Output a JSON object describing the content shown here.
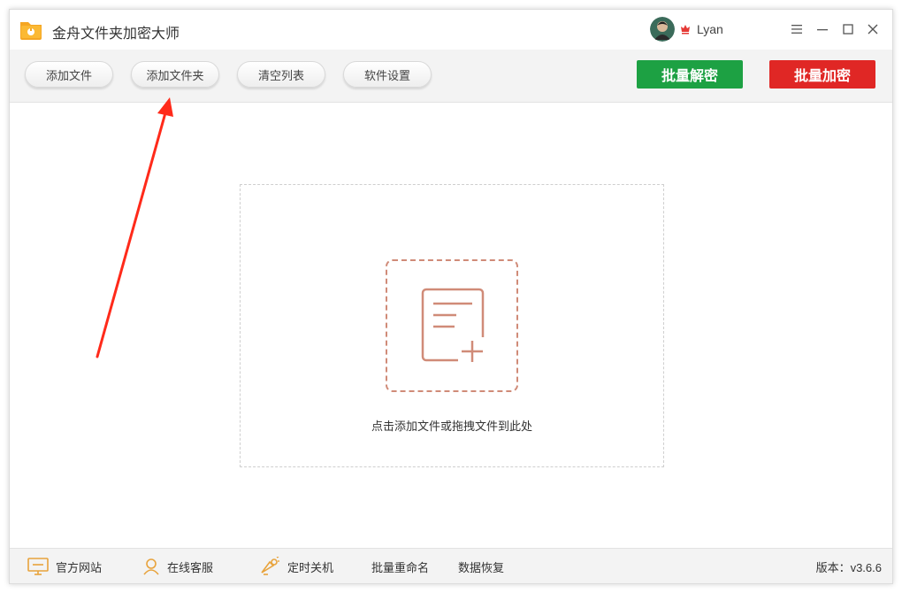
{
  "app": {
    "title": "金舟文件夹加密大师"
  },
  "user": {
    "name": "Lyan"
  },
  "toolbar": {
    "buttons": [
      {
        "label": "添加文件"
      },
      {
        "label": "添加文件夹"
      },
      {
        "label": "清空列表"
      },
      {
        "label": "软件设置"
      }
    ],
    "batch_decrypt": "批量解密",
    "batch_encrypt": "批量加密"
  },
  "drop_zone": {
    "hint": "点击添加文件或拖拽文件到此处"
  },
  "statusbar": {
    "items": [
      {
        "label": "官方网站",
        "icon": "monitor-icon"
      },
      {
        "label": "在线客服",
        "icon": "support-person-icon"
      },
      {
        "label": "定时关机",
        "icon": "clock-power-icon"
      },
      {
        "label": "批量重命名"
      },
      {
        "label": "数据恢复"
      }
    ],
    "version": "版本：v3.6.6"
  },
  "colors": {
    "decrypt_green": "#1da143",
    "encrypt_red": "#e02725",
    "accent_orange": "#d08b78",
    "arrow_red": "#ff2a1a"
  }
}
